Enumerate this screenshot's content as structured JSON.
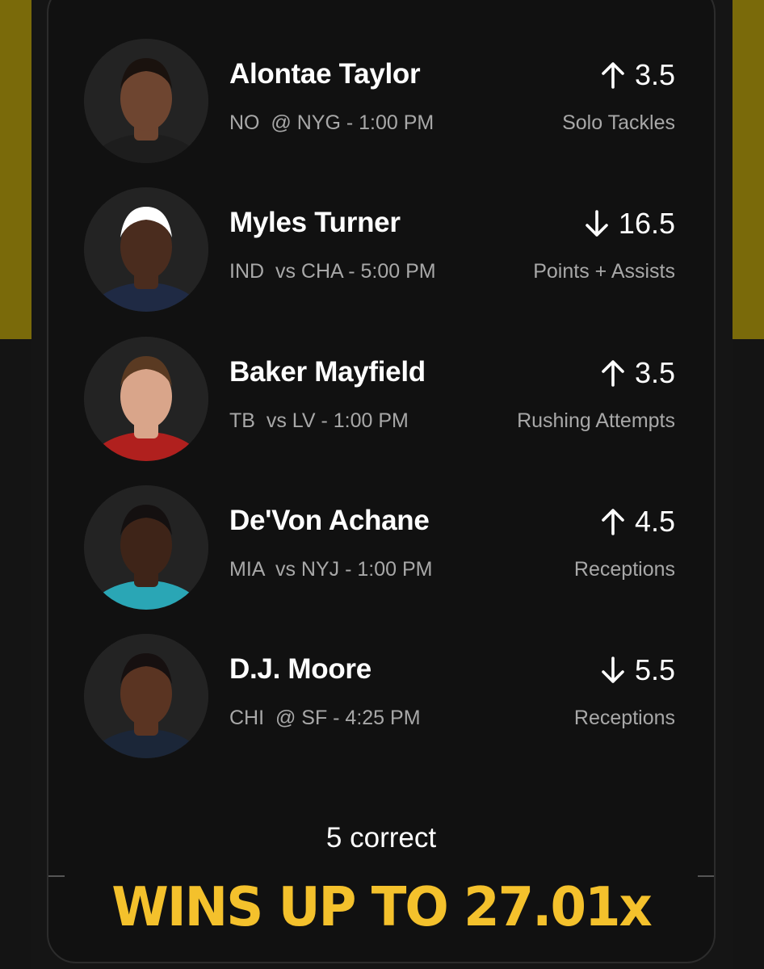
{
  "theme": {
    "gold": "#7a6a0a",
    "accent_yellow": "#f4c12c",
    "card_bg": "#111111"
  },
  "picks": [
    {
      "name": "Alontae Taylor",
      "team": "NO",
      "game": "@ NYG - 1:00 PM",
      "direction": "up",
      "arrow_icon": "arrow-up-icon",
      "line": "3.5",
      "stat": "Solo Tackles",
      "skin": "#6e4530",
      "jersey": "#1d1d1d",
      "hair": "#1a120e"
    },
    {
      "name": "Myles Turner",
      "team": "IND",
      "game": "vs CHA - 5:00 PM",
      "direction": "down",
      "arrow_icon": "arrow-down-icon",
      "line": "16.5",
      "stat": "Points + Assists",
      "skin": "#4a2c1e",
      "jersey": "#1f2a44",
      "hair": "#ffffff"
    },
    {
      "name": "Baker Mayfield",
      "team": "TB",
      "game": "vs LV - 1:00 PM",
      "direction": "up",
      "arrow_icon": "arrow-up-icon",
      "line": "3.5",
      "stat": "Rushing Attempts",
      "skin": "#d9a58a",
      "jersey": "#b0201e",
      "hair": "#5a3a22"
    },
    {
      "name": "De'Von Achane",
      "team": "MIA",
      "game": "vs NYJ - 1:00 PM",
      "direction": "up",
      "arrow_icon": "arrow-up-icon",
      "line": "4.5",
      "stat": "Receptions",
      "skin": "#3e2418",
      "jersey": "#2aa6b5",
      "hair": "#141010"
    },
    {
      "name": "D.J. Moore",
      "team": "CHI",
      "game": "@ SF - 4:25 PM",
      "direction": "down",
      "arrow_icon": "arrow-down-icon",
      "line": "5.5",
      "stat": "Receptions",
      "skin": "#5a3422",
      "jersey": "#1b2638",
      "hair": "#161010"
    }
  ],
  "summary": {
    "correct_label": "5 correct"
  },
  "payout": {
    "label": "WINS UP TO 27.01x"
  }
}
